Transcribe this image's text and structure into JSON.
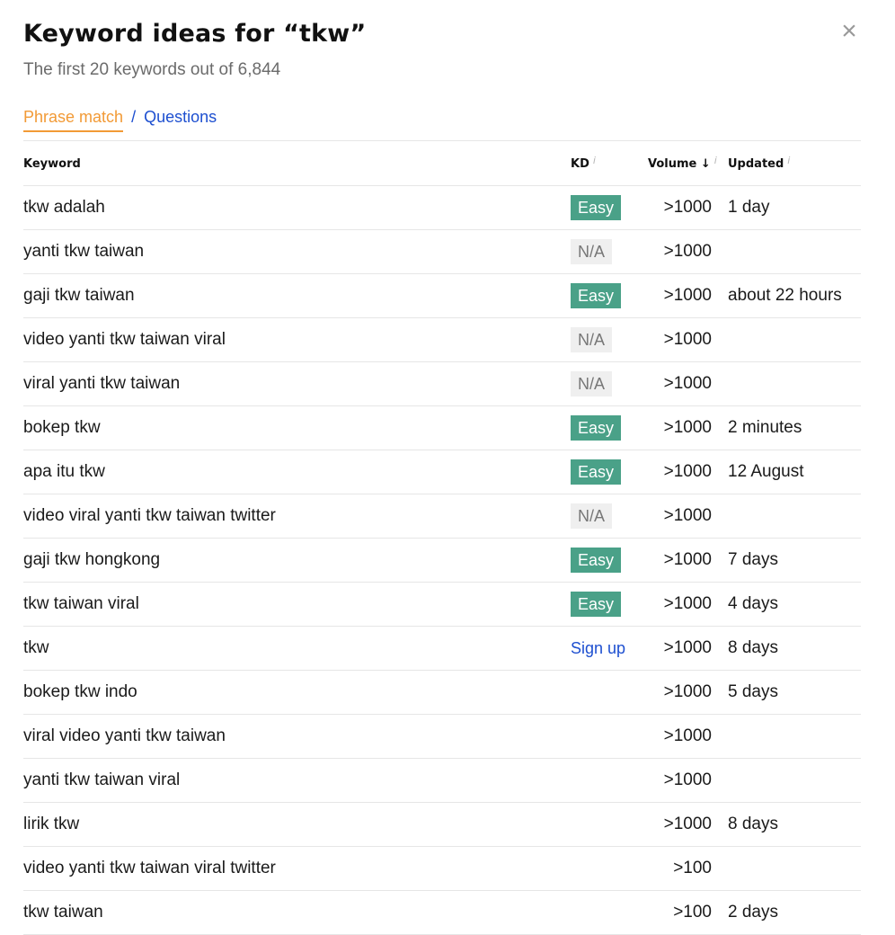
{
  "dialog": {
    "title": "Keyword ideas for “tkw”",
    "subtitle": "The first 20 keywords out of 6,844",
    "close_icon": "×"
  },
  "tabs": {
    "phrase_match": "Phrase match",
    "separator": "/",
    "questions": "Questions"
  },
  "table": {
    "headers": {
      "keyword": "Keyword",
      "kd": "KD",
      "volume": "Volume ↓",
      "updated": "Updated",
      "info_glyph": "i"
    },
    "rows": [
      {
        "keyword": "tkw adalah",
        "kd": "Easy",
        "kd_type": "easy",
        "volume": ">1000",
        "updated": "1 day"
      },
      {
        "keyword": "yanti tkw taiwan",
        "kd": "N/A",
        "kd_type": "na",
        "volume": ">1000",
        "updated": ""
      },
      {
        "keyword": "gaji tkw taiwan",
        "kd": "Easy",
        "kd_type": "easy",
        "volume": ">1000",
        "updated": "about 22 hours"
      },
      {
        "keyword": "video yanti tkw taiwan viral",
        "kd": "N/A",
        "kd_type": "na",
        "volume": ">1000",
        "updated": ""
      },
      {
        "keyword": "viral yanti tkw taiwan",
        "kd": "N/A",
        "kd_type": "na",
        "volume": ">1000",
        "updated": ""
      },
      {
        "keyword": "bokep tkw",
        "kd": "Easy",
        "kd_type": "easy",
        "volume": ">1000",
        "updated": "2 minutes"
      },
      {
        "keyword": "apa itu tkw",
        "kd": "Easy",
        "kd_type": "easy",
        "volume": ">1000",
        "updated": "12 August"
      },
      {
        "keyword": "video viral yanti tkw taiwan twitter",
        "kd": "N/A",
        "kd_type": "na",
        "volume": ">1000",
        "updated": ""
      },
      {
        "keyword": "gaji tkw hongkong",
        "kd": "Easy",
        "kd_type": "easy",
        "volume": ">1000",
        "updated": "7 days"
      },
      {
        "keyword": "tkw taiwan viral",
        "kd": "Easy",
        "kd_type": "easy",
        "volume": ">1000",
        "updated": "4 days"
      },
      {
        "keyword": "tkw",
        "kd": "Sign up",
        "kd_type": "signup",
        "volume": ">1000",
        "updated": "8 days"
      },
      {
        "keyword": "bokep tkw indo",
        "kd": "",
        "kd_type": "none",
        "volume": ">1000",
        "updated": "5 days"
      },
      {
        "keyword": "viral video yanti tkw taiwan",
        "kd": "",
        "kd_type": "none",
        "volume": ">1000",
        "updated": ""
      },
      {
        "keyword": "yanti tkw taiwan viral",
        "kd": "",
        "kd_type": "none",
        "volume": ">1000",
        "updated": ""
      },
      {
        "keyword": "lirik tkw",
        "kd": "",
        "kd_type": "none",
        "volume": ">1000",
        "updated": "8 days"
      },
      {
        "keyword": "video yanti tkw taiwan viral twitter",
        "kd": "",
        "kd_type": "none",
        "volume": ">100",
        "updated": ""
      },
      {
        "keyword": "tkw taiwan",
        "kd": "",
        "kd_type": "none",
        "volume": ">100",
        "updated": "2 days"
      }
    ]
  },
  "colors": {
    "accent_orange": "#f29a36",
    "link_blue": "#1d4fd0",
    "easy_green": "#4aa188",
    "na_gray_bg": "#efefef"
  }
}
